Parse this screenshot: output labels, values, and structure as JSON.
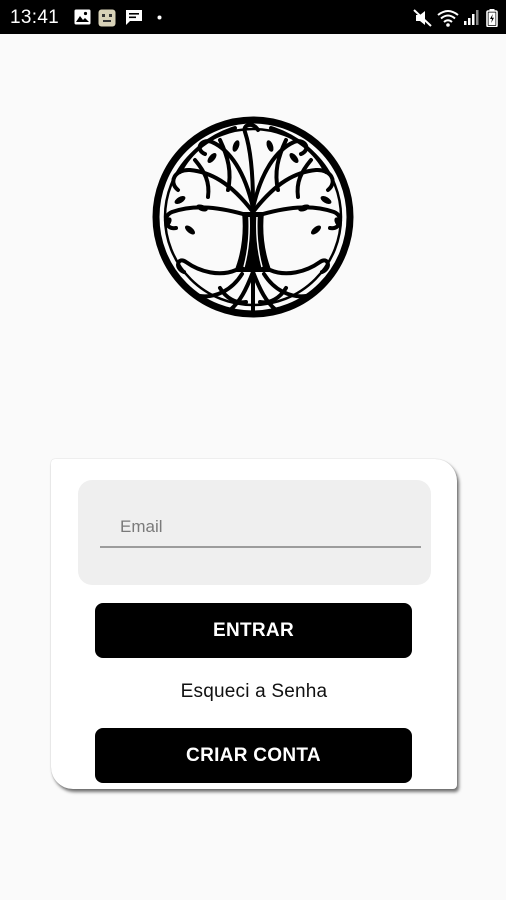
{
  "status_bar": {
    "time": "13:41",
    "icons": [
      "image-icon",
      "face-icon",
      "message-icon",
      "dot-icon",
      "mute-icon",
      "wifi-icon",
      "signal-icon",
      "battery-icon"
    ]
  },
  "logo": {
    "icon": "tree-of-life-icon"
  },
  "login_card": {
    "email_placeholder": "Email",
    "email_value": "",
    "login_button": "ENTRAR",
    "forgot_password": "Esqueci a Senha",
    "create_account_button": "CRIAR CONTA"
  },
  "colors": {
    "background": "#fafafa",
    "status_bar": "#000000",
    "button": "#000000",
    "button_text": "#ffffff",
    "input_box": "#efefef"
  }
}
